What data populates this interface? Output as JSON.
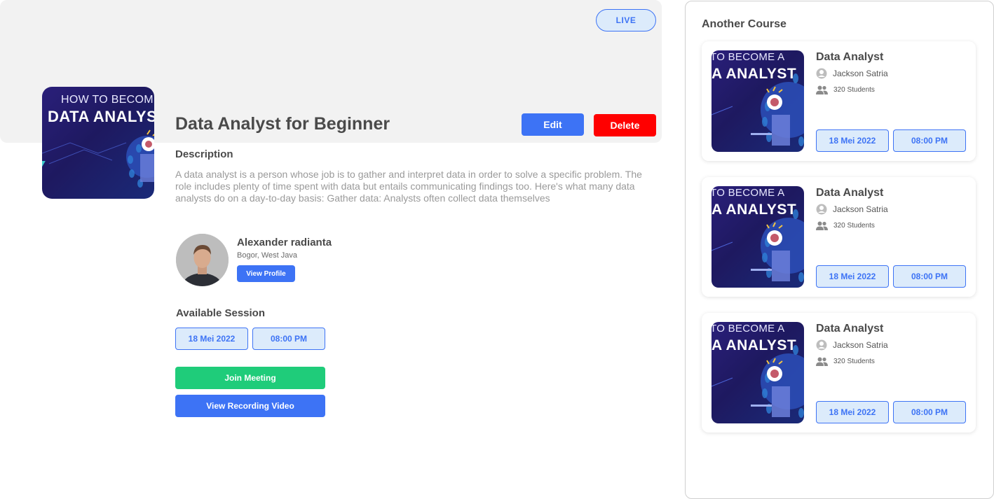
{
  "banner": {
    "live_label": "LIVE"
  },
  "course": {
    "thumb_line1": "HOW TO BECOME A",
    "thumb_line2": "DATA ANALYST",
    "title": "Data Analyst for Beginner",
    "edit_label": "Edit",
    "delete_label": "Delete",
    "description_heading": "Description",
    "description": "A data analyst is a person whose job is to gather and interpret data in order to solve a specific problem. The role includes plenty of time spent with data but entails communicating findings too. Here's what many data analysts do on a day-to-day basis: Gather data: Analysts often collect data themselves"
  },
  "mentor": {
    "name": "Alexander radianta",
    "location": "Bogor, West Java",
    "view_profile_label": "View Profile"
  },
  "session": {
    "heading": "Available Session",
    "date": "18 Mei 2022",
    "time": "08:00 PM",
    "join_label": "Join Meeting",
    "recording_label": "View Recording Video"
  },
  "sidebar": {
    "title": "Another Course",
    "cards": [
      {
        "thumb_line1": "TO BECOME A",
        "thumb_line2": "A ANALYST",
        "title": "Data Analyst",
        "author": "Jackson Satria",
        "students": "320 Students",
        "date": "18 Mei 2022",
        "time": "08:00 PM"
      },
      {
        "thumb_line1": "TO BECOME A",
        "thumb_line2": "A ANALYST",
        "title": "Data Analyst",
        "author": "Jackson Satria",
        "students": "320 Students",
        "date": "18 Mei 2022",
        "time": "08:00 PM"
      },
      {
        "thumb_line1": "TO BECOME A",
        "thumb_line2": "A ANALYST",
        "title": "Data Analyst",
        "author": "Jackson Satria",
        "students": "320 Students",
        "date": "18 Mei 2022",
        "time": "08:00 PM"
      }
    ]
  },
  "colors": {
    "primary": "#3d73f5",
    "danger": "#ff0000",
    "success": "#1fcc7a",
    "pill_bg": "#dcebfb",
    "thumb_bg": "#1e1960"
  }
}
